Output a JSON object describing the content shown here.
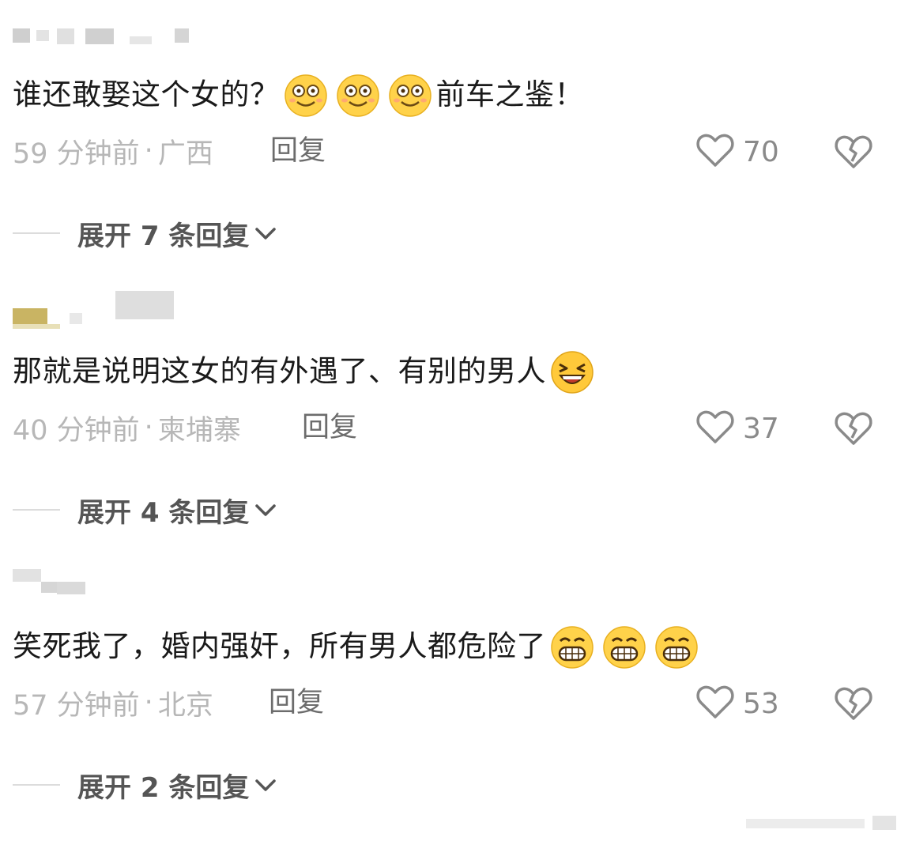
{
  "comments": [
    {
      "text_a": "谁还敢娶这个女的？",
      "text_b": "前车之鉴！",
      "time": "59 分钟前",
      "dot": "·",
      "location": "广西",
      "reply_label": "回复",
      "like_count": "70",
      "expand_label": "展开 7 条回复",
      "emoji": "smile-emoji",
      "emoji_count": 3
    },
    {
      "text_a": "那就是说明这女的有外遇了、有别的男人",
      "text_b": "",
      "time": "40 分钟前",
      "dot": "·",
      "location": "柬埔寨",
      "reply_label": "回复",
      "like_count": "37",
      "expand_label": "展开 4 条回复",
      "emoji": "laughing-emoji",
      "emoji_count": 1
    },
    {
      "text_a": "笑死我了，婚内强奸，所有男人都危险了",
      "text_b": "",
      "time": "57 分钟前",
      "dot": "·",
      "location": "北京",
      "reply_label": "回复",
      "like_count": "53",
      "expand_label": "展开 2 条回复",
      "emoji": "grin-emoji",
      "emoji_count": 3
    }
  ],
  "icons": {
    "like": "heart-outline-icon",
    "dislike": "broken-heart-icon",
    "expand": "chevron-down-icon"
  },
  "colors": {
    "text": "#1a1a1a",
    "meta": "#b7b7b7",
    "reply": "#6c6c6c",
    "icon": "#8a8a8a",
    "emoji_face": "#ffd24a"
  }
}
